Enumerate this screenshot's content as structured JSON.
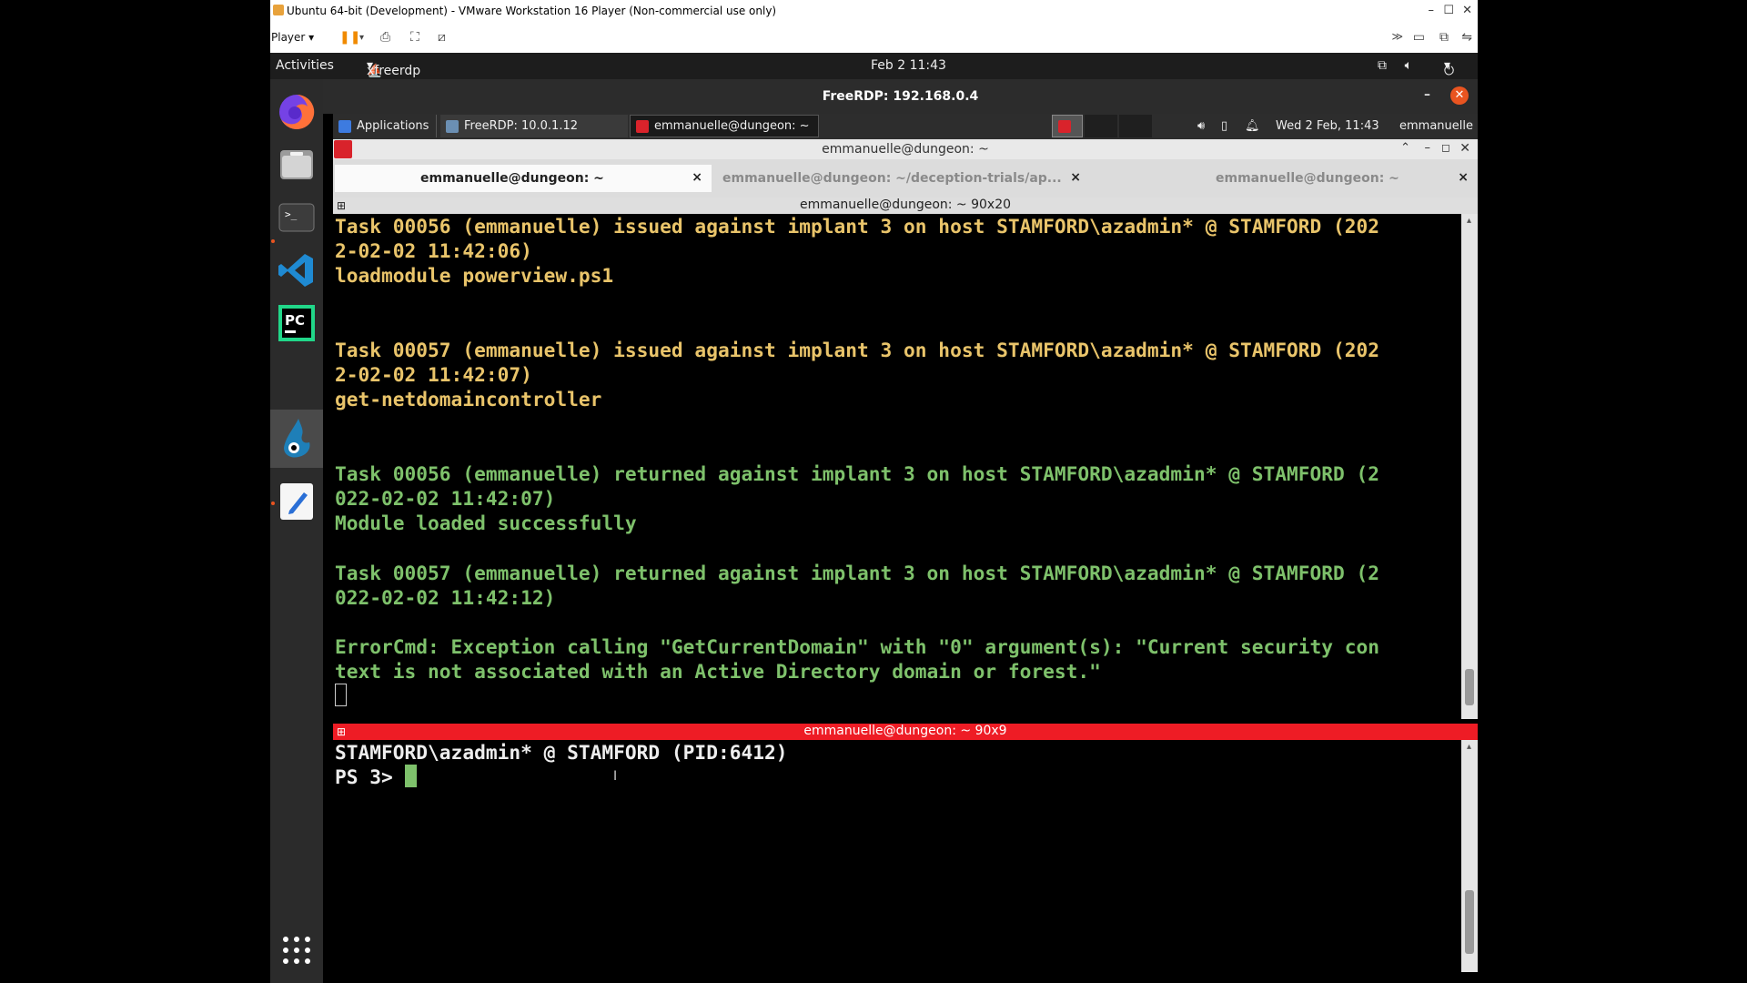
{
  "vmware": {
    "title": "Ubuntu 64-bit (Development) - VMware Workstation 16 Player (Non-commercial use only)",
    "player_menu": "Player",
    "minimize": "–",
    "maximize": "☐",
    "close": "✕"
  },
  "gnome": {
    "activities": "Activities",
    "app_menu": "xfreerdp",
    "clock": "Feb 2  11:43"
  },
  "dock": {
    "items": [
      "firefox",
      "files",
      "terminal",
      "vscode",
      "pycharm",
      "wireshark",
      "text-editor"
    ]
  },
  "rdp": {
    "title": "FreeRDP: 192.168.0.4",
    "close": "✕",
    "minimize": "–"
  },
  "xfce": {
    "applications": "Applications",
    "task1": "FreeRDP: 10.0.1.12",
    "task2": "emmanuelle@dungeon: ~",
    "datetime": "Wed  2 Feb, 11:43",
    "user": "emmanuelle"
  },
  "terminal": {
    "window_title": "emmanuelle@dungeon: ~",
    "tabs": [
      {
        "label": "emmanuelle@dungeon: ~"
      },
      {
        "label": "emmanuelle@dungeon: ~/deception-trials/ap..."
      },
      {
        "label": "emmanuelle@dungeon: ~"
      }
    ],
    "tab_close": "×",
    "pane1_title": "emmanuelle@dungeon: ~ 90x20",
    "pane2_title": "emmanuelle@dungeon: ~ 90x9",
    "pane1_lines": [
      {
        "text": "Task 00056 (emmanuelle) issued against implant 3 on host STAMFORD\\azadmin* @ STAMFORD (202",
        "color": "yellow"
      },
      {
        "text": "2-02-02 11:42:06)",
        "color": "yellow"
      },
      {
        "text": "loadmodule powerview.ps1",
        "color": "yellow"
      },
      {
        "text": "",
        "color": "yellow"
      },
      {
        "text": "",
        "color": "yellow"
      },
      {
        "text": "Task 00057 (emmanuelle) issued against implant 3 on host STAMFORD\\azadmin* @ STAMFORD (202",
        "color": "yellow"
      },
      {
        "text": "2-02-02 11:42:07)",
        "color": "yellow"
      },
      {
        "text": "get-netdomaincontroller",
        "color": "yellow"
      },
      {
        "text": "",
        "color": "yellow"
      },
      {
        "text": "",
        "color": "yellow"
      },
      {
        "text": "Task 00056 (emmanuelle) returned against implant 3 on host STAMFORD\\azadmin* @ STAMFORD (2",
        "color": "green"
      },
      {
        "text": "022-02-02 11:42:07)",
        "color": "green"
      },
      {
        "text": "Module loaded successfully",
        "color": "green"
      },
      {
        "text": "",
        "color": "green"
      },
      {
        "text": "Task 00057 (emmanuelle) returned against implant 3 on host STAMFORD\\azadmin* @ STAMFORD (2",
        "color": "green"
      },
      {
        "text": "022-02-02 11:42:12)",
        "color": "green"
      },
      {
        "text": "",
        "color": "green"
      },
      {
        "text": "ErrorCmd: Exception calling \"GetCurrentDomain\" with \"0\" argument(s): \"Current security con",
        "color": "green"
      },
      {
        "text": "text is not associated with an Active Directory domain or forest.\"",
        "color": "green"
      }
    ],
    "pane2_header": "STAMFORD\\azadmin* @ STAMFORD (PID:6412)",
    "pane2_prompt": "PS 3> "
  },
  "colors": {
    "output_yellow": "#e9c46a",
    "output_green": "#7ec16b",
    "active_pane_title": "#ee1c25",
    "ubuntu_orange": "#e95420"
  }
}
